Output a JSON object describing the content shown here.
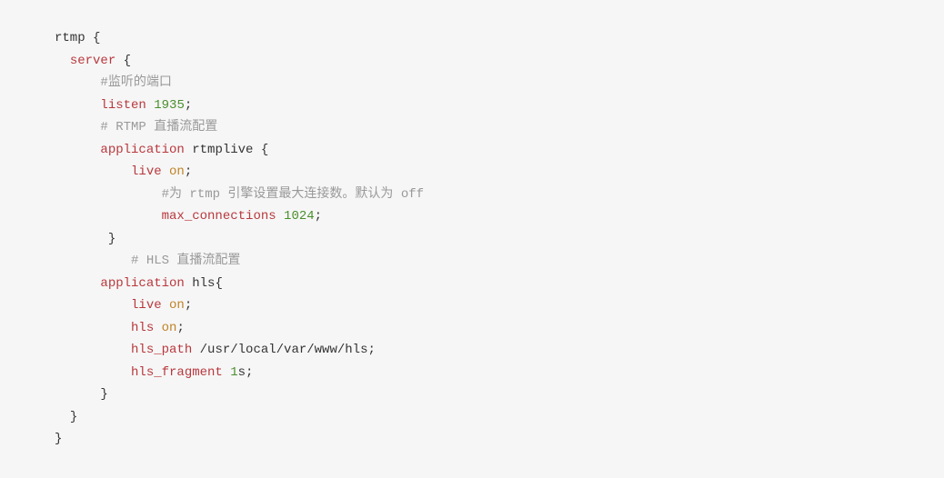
{
  "code": {
    "l1_rtmp": "rtmp",
    "l1_brace": " {",
    "l2_server": "server",
    "l2_brace": " {",
    "l3_comment": "#监听的端口",
    "l4_listen": "listen",
    "l4_num": " 1935",
    "l4_semi": ";",
    "l5_comment": "# RTMP 直播流配置",
    "l6_app": "application",
    "l6_name": " rtmplive {",
    "l7_live": "live",
    "l7_on": " on",
    "l7_semi": ";",
    "l8_comment": "#为 rtmp 引擎设置最大连接数。默认为 off",
    "l9_max": "max_connections",
    "l9_num": " 1024",
    "l9_semi": ";",
    "l10_brace": " }",
    "l11_comment": "# HLS 直播流配置",
    "l12_app": "application",
    "l12_name": " hls{",
    "l13_live": "live",
    "l13_on": " on",
    "l13_semi": ";",
    "l14_hls": "hls",
    "l14_on": " on",
    "l14_semi": ";",
    "l15_path": "hls_path",
    "l15_val": " /usr/local/var/www/hls;",
    "l16_frag": "hls_fragment",
    "l16_num": " 1",
    "l16_s": "s;",
    "l17_brace": "}",
    "l18_brace": "}",
    "l19_brace": "}"
  }
}
